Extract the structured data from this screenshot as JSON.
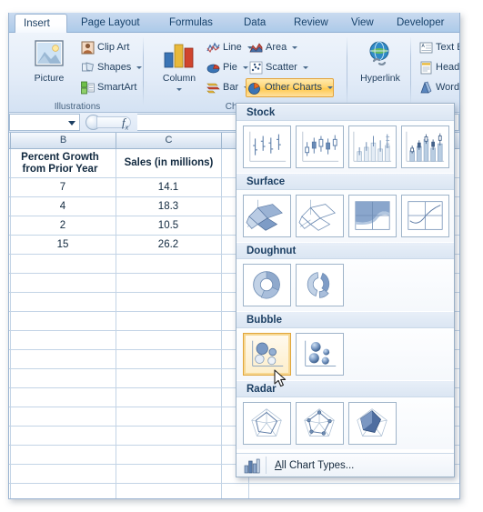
{
  "ribbon": {
    "tabs": [
      {
        "label": "Insert",
        "active": true
      },
      {
        "label": "Page Layout",
        "active": false
      },
      {
        "label": "Formulas",
        "active": false
      },
      {
        "label": "Data",
        "active": false
      },
      {
        "label": "Review",
        "active": false
      },
      {
        "label": "View",
        "active": false
      },
      {
        "label": "Developer",
        "active": false
      }
    ],
    "groups": {
      "illustrations": {
        "label": "Illustrations",
        "picture": "Picture",
        "clip_art": "Clip Art",
        "shapes": "Shapes",
        "smartart": "SmartArt"
      },
      "charts": {
        "label": "Chart",
        "column": "Column",
        "line": "Line",
        "pie": "Pie",
        "bar": "Bar",
        "area": "Area",
        "scatter": "Scatter",
        "other_charts": "Other Charts"
      },
      "links": {
        "hyperlink": "Hyperlink"
      },
      "text": {
        "label": "Te",
        "text_box": "Text Box",
        "header_footer": "Header &",
        "wordart": "WordArt"
      }
    }
  },
  "formula_bar": {
    "name_box_value": "",
    "fx_label": "fx",
    "formula_value": ""
  },
  "sheet": {
    "column_headers": [
      "B",
      "C"
    ],
    "cells": {
      "b1": "Percent Growth",
      "b1_line2": "from Prior Year",
      "c1": "Sales (in millions)"
    },
    "table": {
      "headers": [
        "Percent Growth from Prior Year",
        "Sales (in millions)"
      ],
      "rows": [
        [
          "7",
          "14.1"
        ],
        [
          "4",
          "18.3"
        ],
        [
          "2",
          "10.5"
        ],
        [
          "15",
          "26.2"
        ]
      ]
    }
  },
  "gallery": {
    "sections": [
      {
        "title": "Stock",
        "count": 4,
        "selected": -1
      },
      {
        "title": "Surface",
        "count": 4,
        "selected": -1
      },
      {
        "title": "Doughnut",
        "count": 2,
        "selected": -1
      },
      {
        "title": "Bubble",
        "count": 2,
        "selected": 0
      },
      {
        "title": "Radar",
        "count": 3,
        "selected": -1
      }
    ],
    "footer": {
      "accel": "A",
      "label_rest": "ll Chart Types..."
    }
  },
  "colors": {
    "accent_highlight": "#ffc94f",
    "selection_border": "#e0a63c",
    "ribbon_text": "#1f3d5c",
    "chart_blue": "#4a6fa5"
  }
}
